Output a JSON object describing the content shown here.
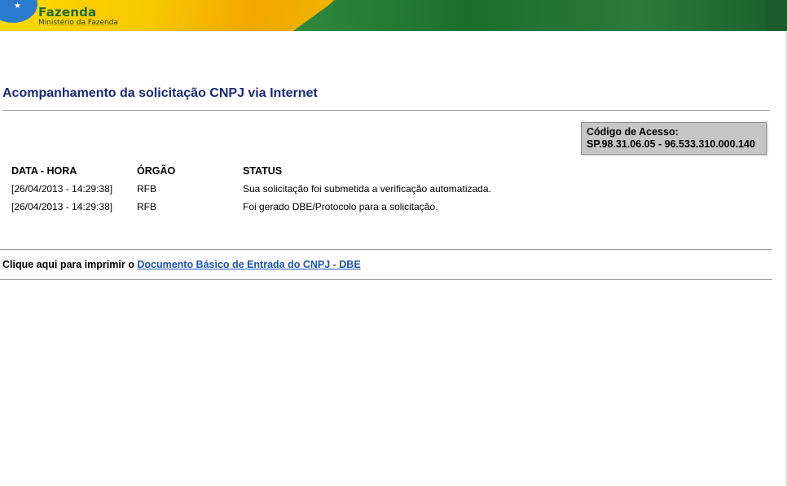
{
  "header": {
    "brand_title": "Fazenda",
    "brand_subtitle": "Ministério da Fazenda",
    "colors": {
      "yellow": "#f6d000",
      "green": "#1e6b31",
      "blue": "#2a7bd0"
    }
  },
  "page": {
    "title": "Acompanhamento da solicitação CNPJ via Internet"
  },
  "access_code": {
    "label": "Código de Acesso:",
    "value": "SP.98.31.06.05 - 96.533.310.000.140"
  },
  "status_table": {
    "columns": [
      "DATA - HORA",
      "ÓRGÃO",
      "STATUS"
    ],
    "rows": [
      {
        "datetime": "[26/04/2013 - 14:29:38]",
        "org": "RFB",
        "status": "Sua solicitação foi submetida a verificação automatizada."
      },
      {
        "datetime": "[26/04/2013 - 14:29:38]",
        "org": "RFB",
        "status": "Foi gerado DBE/Protocolo para a solicitação."
      }
    ]
  },
  "print": {
    "prefix": "Clique aqui para imprimir o",
    "link_text": "Documento Básico de Entrada do CNPJ - DBE"
  }
}
